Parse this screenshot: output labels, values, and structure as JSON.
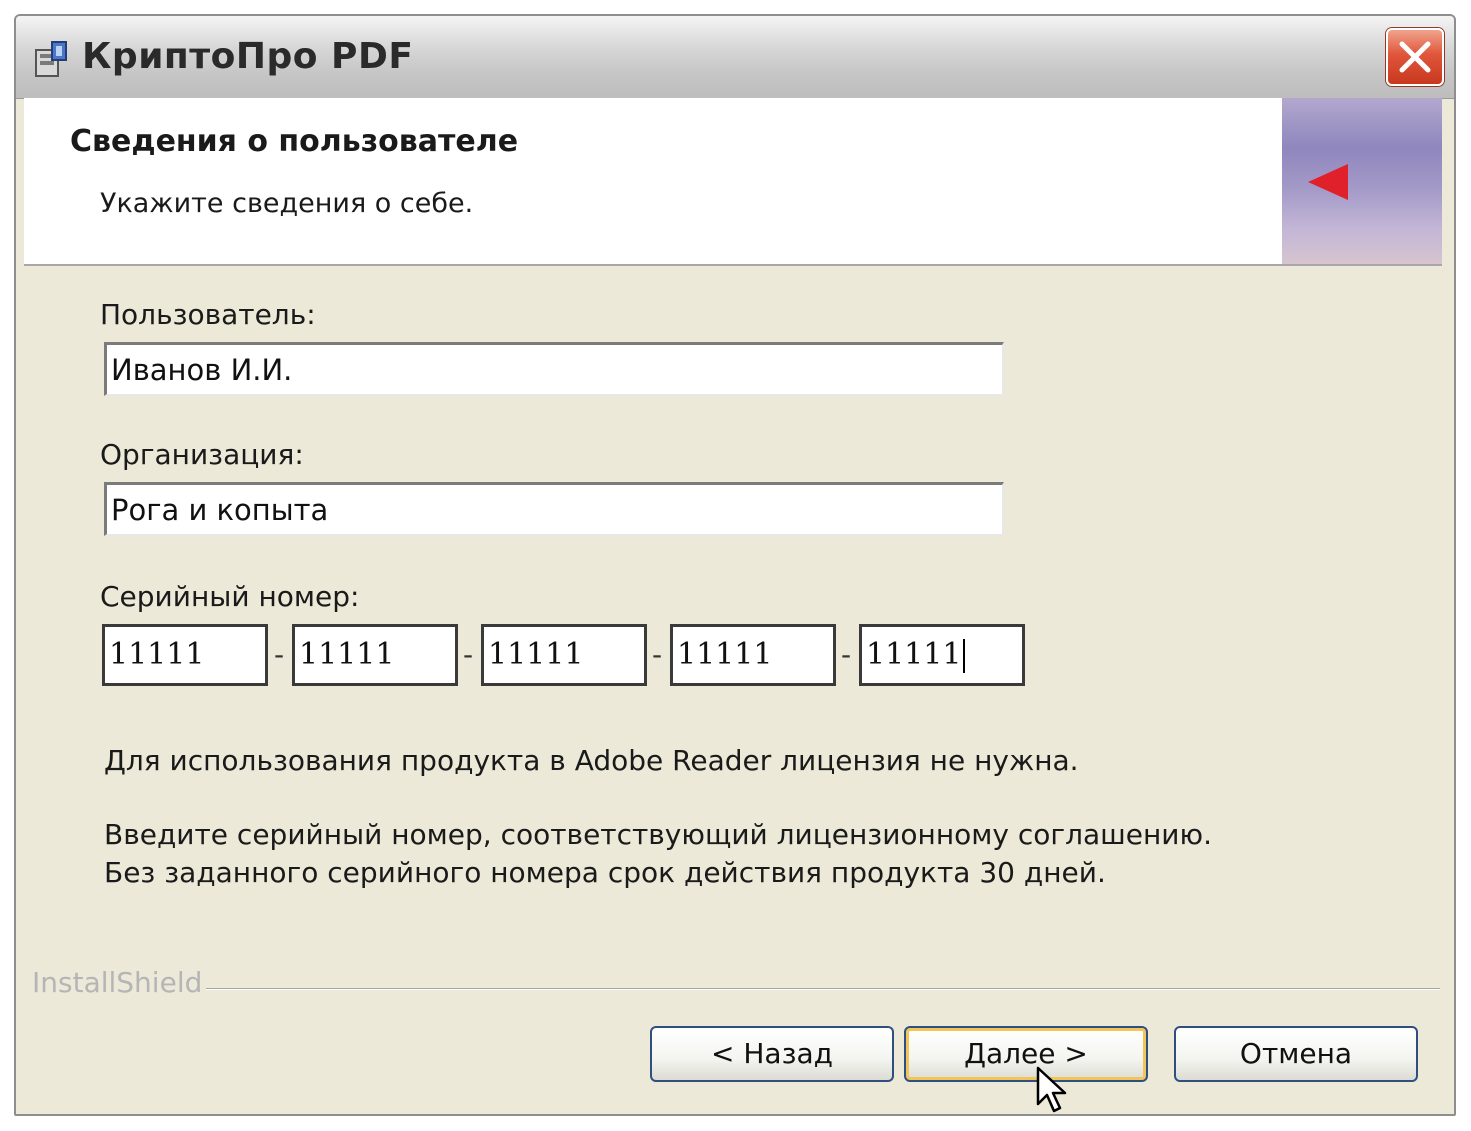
{
  "window": {
    "title": "КриптоПро PDF"
  },
  "banner": {
    "title": "Сведения о пользователе",
    "subtitle": "Укажите сведения о себе."
  },
  "form": {
    "user_label": "Пользователь:",
    "user_value": "Иванов И.И.",
    "org_label": "Организация:",
    "org_value": "Рога и копыта",
    "serial_label": "Серийный номер:",
    "serial_parts": [
      "11111",
      "11111",
      "11111",
      "11111",
      "11111"
    ],
    "serial_separator": "-"
  },
  "info": {
    "line1": "Для использования продукта в Adobe Reader лицензия не нужна.",
    "line2": "Введите серийный номер, соответствующий лицензионному соглашению.",
    "line3": "Без заданного серийного номера срок действия продукта 30 дней."
  },
  "footer": {
    "brand": "InstallShield",
    "back_label": "< Назад",
    "next_label": "Далее >",
    "cancel_label": "Отмена"
  },
  "icons": {
    "app": "installer-icon",
    "close": "close-icon",
    "banner": "red-arrow-icon",
    "cursor": "mouse-cursor-icon"
  },
  "colors": {
    "dialog_bg": "#ece9d8",
    "close_button": "#e0563b",
    "default_button_highlight": "#f2c558",
    "banner_arrow": "#e0202a"
  }
}
